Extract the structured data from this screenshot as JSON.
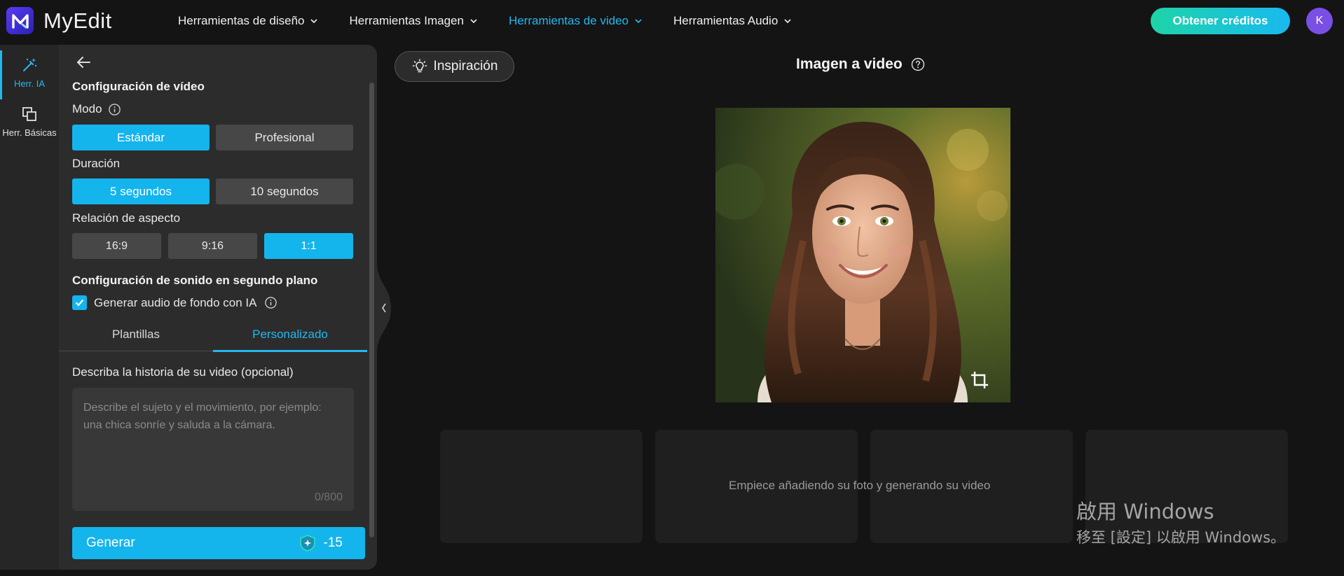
{
  "app": {
    "name": "MyEdit",
    "logo_letter": "M"
  },
  "nav": {
    "items": [
      {
        "label": "Herramientas de diseño",
        "active": false
      },
      {
        "label": "Herramientas Imagen",
        "active": false
      },
      {
        "label": "Herramientas de video",
        "active": true
      },
      {
        "label": "Herramientas Audio",
        "active": false
      }
    ],
    "credits_button": "Obtener créditos",
    "avatar_initial": "K"
  },
  "rail": {
    "ai_tools": "Herr. IA",
    "basic_tools": "Herr. Básicas"
  },
  "settings": {
    "title": "Configuración de vídeo",
    "mode_label": "Modo",
    "mode_options": [
      "Estándar",
      "Profesional"
    ],
    "mode_selected": "Estándar",
    "duration_label": "Duración",
    "duration_options": [
      "5 segundos",
      "10 segundos"
    ],
    "duration_selected": "5 segundos",
    "aspect_label": "Relación de aspecto",
    "aspect_options": [
      "16:9",
      "9:16",
      "1:1"
    ],
    "aspect_selected": "1:1",
    "sound_title": "Configuración de sonido en segundo plano",
    "sound_checkbox": "Generar audio de fondo con IA",
    "sound_checked": true,
    "tabs": [
      "Plantillas",
      "Personalizado"
    ],
    "active_tab": "Personalizado",
    "story_label": "Describa la historia de su video (opcional)",
    "story_placeholder": "Describe el sujeto y el movimiento, por ejemplo: una chica sonríe y saluda a la cámara.",
    "story_value": "",
    "counter": "0/800",
    "generate_label": "Generar",
    "generate_cost": "-15"
  },
  "main": {
    "inspiration_button": "Inspiración",
    "title": "Imagen a video",
    "empty_message": "Empiece añadiendo su foto y generando su video"
  },
  "watermark": {
    "line1": "啟用 Windows",
    "line2": "移至 [設定] 以啟用 Windows。"
  },
  "colors": {
    "accent": "#14b4ec",
    "brand": "#5b3df5",
    "background": "#141414",
    "panel": "#2c2c2c"
  }
}
